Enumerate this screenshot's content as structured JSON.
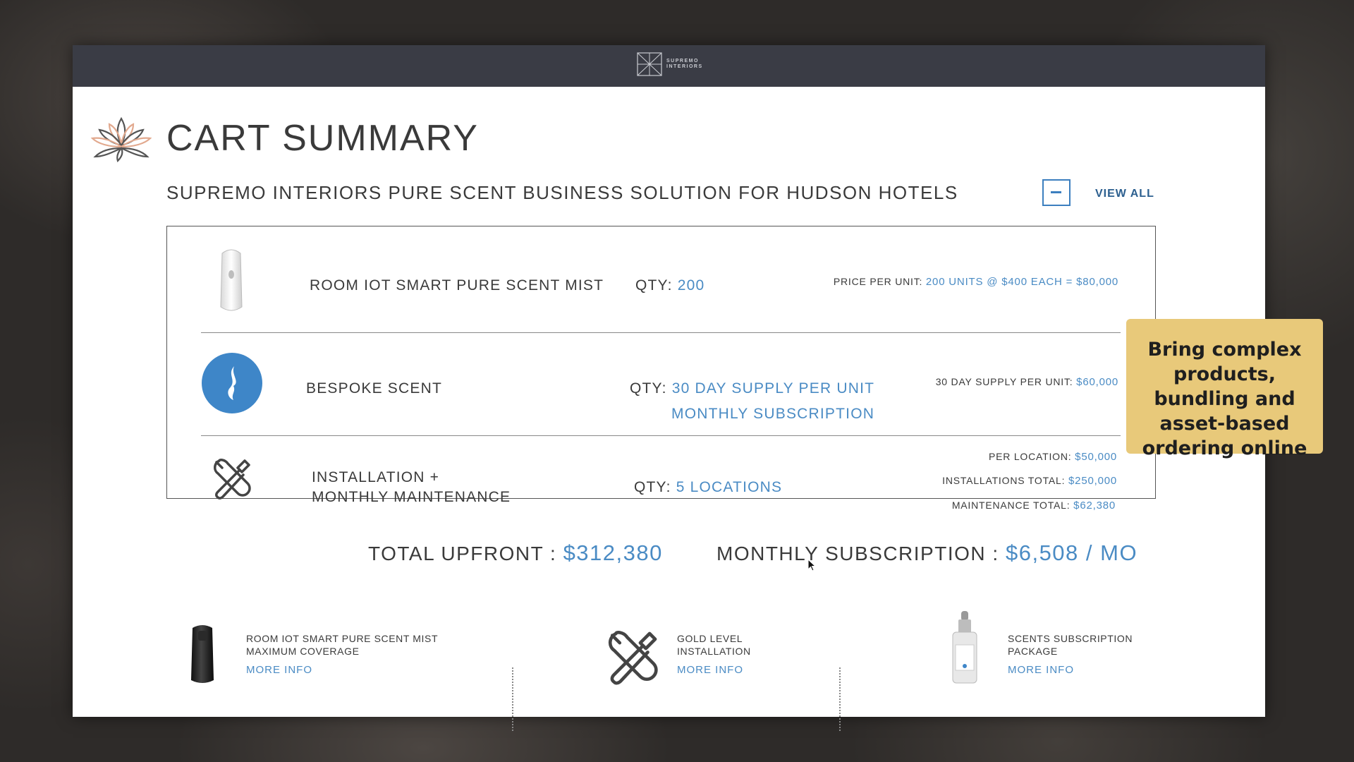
{
  "brand": {
    "line1": "SUPREMO",
    "line2": "INTERIORS"
  },
  "page_title": "CART SUMMARY",
  "subtitle": "SUPREMO INTERIORS PURE SCENT BUSINESS SOLUTION FOR HUDSON HOTELS",
  "view_all": "VIEW ALL",
  "items": [
    {
      "name": "ROOM IOT SMART PURE SCENT MIST",
      "qty_label": "QTY:",
      "qty_value": "200",
      "price_label": "PRICE PER UNIT:",
      "price_value": "200 UNITS @ $400 EACH = $80,000"
    },
    {
      "name": "BESPOKE SCENT",
      "qty_label": "QTY:",
      "qty_value_line1": "30 DAY SUPPLY PER UNIT",
      "qty_value_line2": "MONTHLY SUBSCRIPTION",
      "price_label": "30 DAY SUPPLY PER UNIT:",
      "price_value": "$60,000"
    },
    {
      "name_line1": "INSTALLATION +",
      "name_line2": "MONTHLY MAINTENANCE",
      "qty_label": "QTY:",
      "qty_value": "5 LOCATIONS",
      "per_location_label": "PER LOCATION:",
      "per_location_value": "$50,000",
      "install_total_label": "INSTALLATIONS TOTAL:",
      "install_total_value": "$250,000",
      "maint_total_label": "MAINTENANCE TOTAL:",
      "maint_total_value": "$62,380"
    }
  ],
  "totals": {
    "upfront_label": "TOTAL UPFRONT :",
    "upfront_value": "$312,380",
    "monthly_label": "MONTHLY SUBSCRIPTION :",
    "monthly_value": "$6,508 / MO"
  },
  "recommendations": [
    {
      "line1": "ROOM IOT SMART PURE SCENT MIST",
      "line2": "MAXIMUM COVERAGE",
      "link": "MORE INFO"
    },
    {
      "line1": "GOLD LEVEL",
      "line2": "INSTALLATION",
      "link": "MORE INFO"
    },
    {
      "line1": "SCENTS SUBSCRIPTION",
      "line2": "PACKAGE",
      "link": "MORE INFO"
    }
  ],
  "callout": "Bring complex products, bundling and asset-based ordering online",
  "colors": {
    "accent": "#4a8bc4",
    "topbar": "#3a3c45",
    "callout": "#e8c97a"
  }
}
